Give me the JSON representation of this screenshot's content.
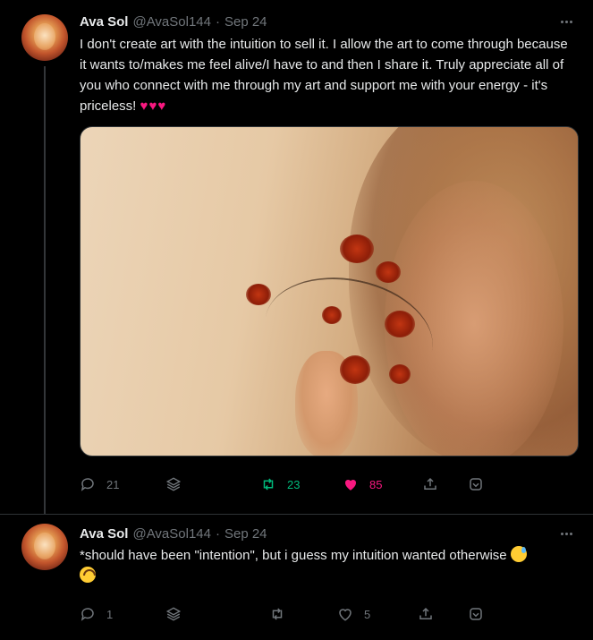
{
  "tweets": [
    {
      "author": {
        "name": "Ava Sol",
        "handle": "@AvaSol144",
        "date": "Sep 24"
      },
      "text": "I don't create art with the intuition to sell it. I allow the art to come through because it wants to/makes me feel alive/I have to and then I share it. Truly appreciate all of you who connect with me through my art and support me with your energy - it's priceless!",
      "text_suffix": "♥♥♥",
      "media": {
        "kind": "photo"
      },
      "actions": {
        "replies": "21",
        "retweets": "23",
        "likes": "85",
        "retweeted": true,
        "liked": true
      }
    },
    {
      "author": {
        "name": "Ava Sol",
        "handle": "@AvaSol144",
        "date": "Sep 24"
      },
      "text": "*should have been \"intention\", but i guess my intuition wanted otherwise",
      "actions": {
        "replies": "1",
        "retweets": "",
        "likes": "5",
        "retweeted": false,
        "liked": false
      }
    }
  ],
  "colors": {
    "background": "#000000",
    "text": "#e7e9ea",
    "muted": "#71767b",
    "retweet": "#00ba7c",
    "like": "#f91880"
  },
  "icons": [
    "more-icon",
    "reply-icon",
    "stack-icon",
    "retweet-icon",
    "like-icon",
    "share-icon",
    "bookmark-icon"
  ]
}
